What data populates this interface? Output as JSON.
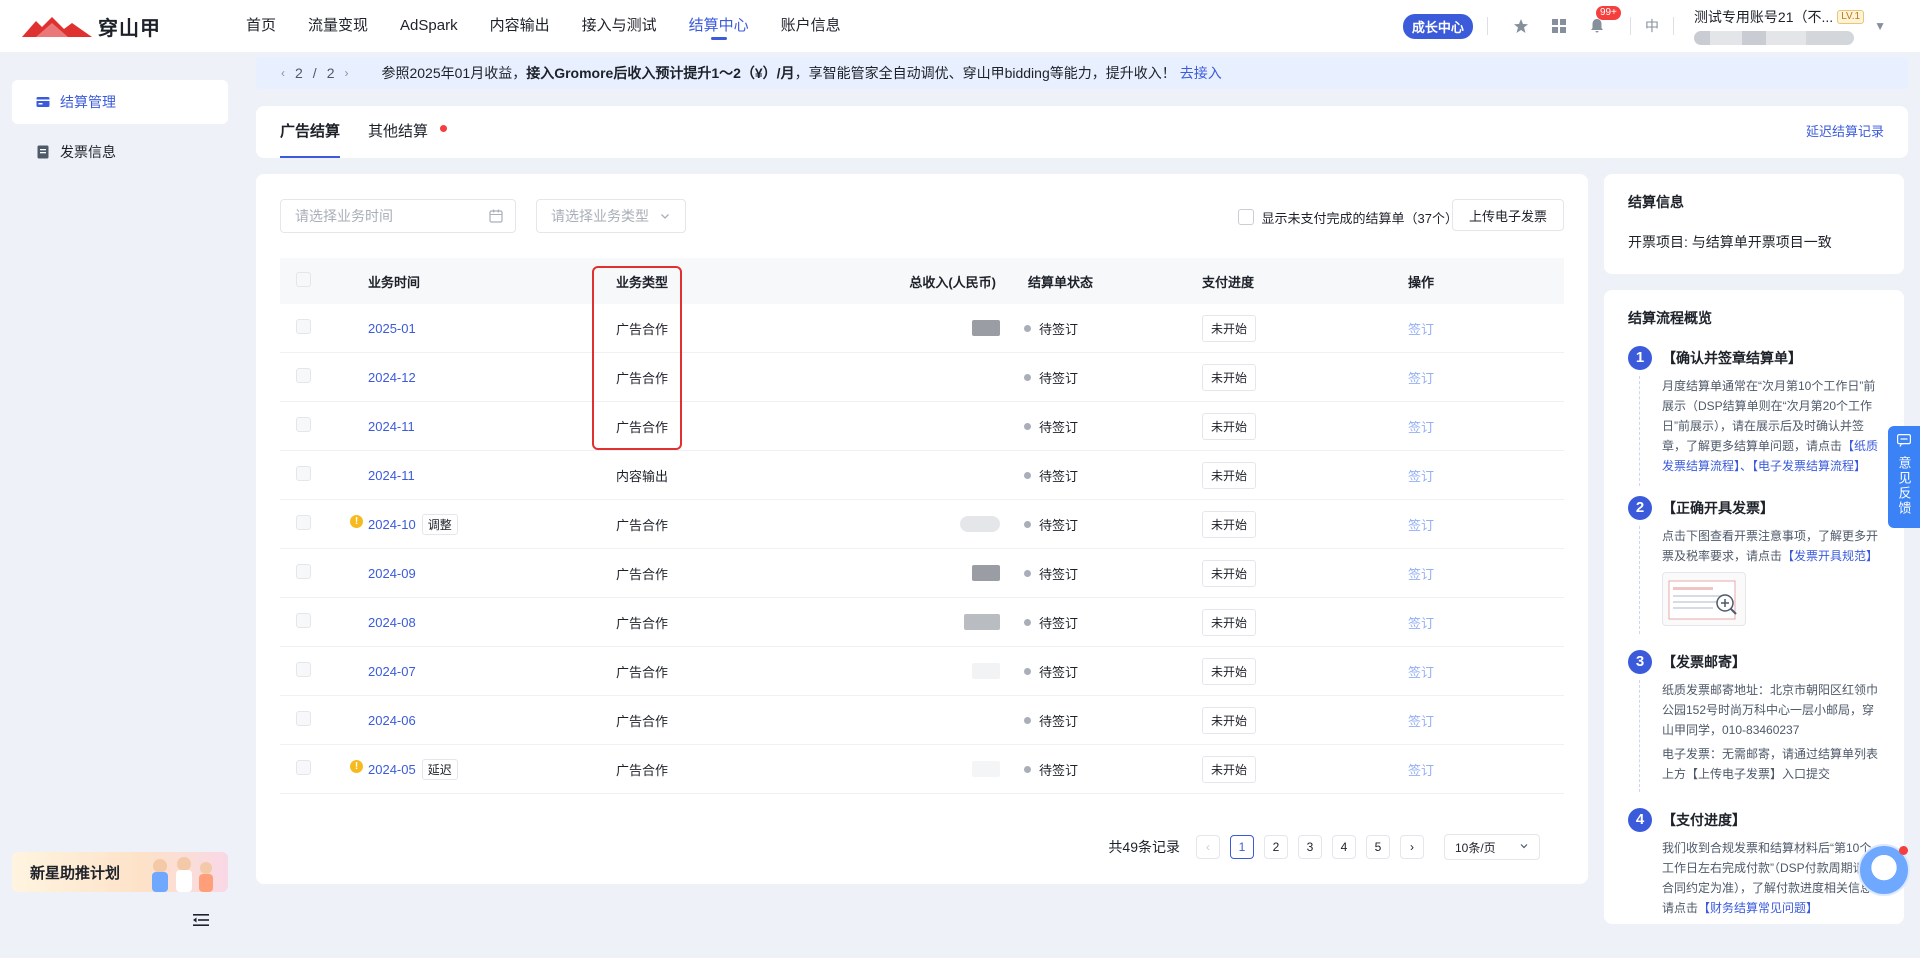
{
  "brand": {
    "name": "穿山甲"
  },
  "nav": {
    "items": [
      "首页",
      "流量变现",
      "AdSpark",
      "内容输出",
      "接入与测试",
      "结算中心",
      "账户信息"
    ],
    "active_index": 5
  },
  "header": {
    "grow_center": "成长中心",
    "notif_count": "99+",
    "lang": "中",
    "account_name": "测试专用账号21（不...",
    "level": "LV.1"
  },
  "sidebar": {
    "items": [
      {
        "label": "结算管理",
        "icon": "settlement-icon",
        "active": true
      },
      {
        "label": "发票信息",
        "icon": "invoice-icon",
        "active": false
      }
    ],
    "promo": "新星助推计划"
  },
  "notice": {
    "page_current": "2",
    "page_sep": "/",
    "page_total": "2",
    "text_before": "参照2025年01月收益，",
    "text_bold": "接入Gromore后收入预计提升1～2（¥）/月",
    "text_after": "，享智能管家全自动调优、穿山甲bidding等能力，提升收入！",
    "link": "去接入"
  },
  "tabs": {
    "items": [
      "广告结算",
      "其他结算"
    ],
    "delay_link": "延迟结算记录"
  },
  "filters": {
    "time_placeholder": "请选择业务时间",
    "type_placeholder": "请选择业务类型",
    "unpaid_label": "显示未支付完成的结算单（37个）",
    "upload_button": "上传电子发票"
  },
  "table": {
    "headers": [
      "业务时间",
      "业务类型",
      "总收入(人民币)",
      "结算单状态",
      "支付进度",
      "操作"
    ],
    "rows": [
      {
        "time": "2025-01",
        "tag": "",
        "warn": false,
        "type": "广告合作",
        "status": "待签订",
        "progress": "未开始",
        "op": "签订"
      },
      {
        "time": "2024-12",
        "tag": "",
        "warn": false,
        "type": "广告合作",
        "status": "待签订",
        "progress": "未开始",
        "op": "签订"
      },
      {
        "time": "2024-11",
        "tag": "",
        "warn": false,
        "type": "广告合作",
        "status": "待签订",
        "progress": "未开始",
        "op": "签订"
      },
      {
        "time": "2024-11",
        "tag": "",
        "warn": false,
        "type": "内容输出",
        "status": "待签订",
        "progress": "未开始",
        "op": "签订"
      },
      {
        "time": "2024-10",
        "tag": "调整",
        "warn": true,
        "type": "广告合作",
        "status": "待签订",
        "progress": "未开始",
        "op": "签订"
      },
      {
        "time": "2024-09",
        "tag": "",
        "warn": false,
        "type": "广告合作",
        "status": "待签订",
        "progress": "未开始",
        "op": "签订"
      },
      {
        "time": "2024-08",
        "tag": "",
        "warn": false,
        "type": "广告合作",
        "status": "待签订",
        "progress": "未开始",
        "op": "签订"
      },
      {
        "time": "2024-07",
        "tag": "",
        "warn": false,
        "type": "广告合作",
        "status": "待签订",
        "progress": "未开始",
        "op": "签订"
      },
      {
        "time": "2024-06",
        "tag": "",
        "warn": false,
        "type": "广告合作",
        "status": "待签订",
        "progress": "未开始",
        "op": "签订"
      },
      {
        "time": "2024-05",
        "tag": "延迟",
        "warn": true,
        "type": "广告合作",
        "status": "待签订",
        "progress": "未开始",
        "op": "签订"
      }
    ]
  },
  "pagination": {
    "total": "共49条记录",
    "pages": [
      "1",
      "2",
      "3",
      "4",
      "5"
    ],
    "current": "1",
    "page_size": "10条/页"
  },
  "settlement_info": {
    "title": "结算信息",
    "text": "开票项目: 与结算单开票项目一致"
  },
  "flow": {
    "title": "结算流程概览",
    "steps": [
      {
        "num": "1",
        "title": "【确认并签章结算单】",
        "desc": "月度结算单通常在“次月第10个工作日”前展示（DSP结算单则在“次月第20个工作日”前展示），请在展示后及时确认并签章，了解更多结算单问题，请点击",
        "link": "【纸质发票结算流程】、【电子发票结算流程】"
      },
      {
        "num": "2",
        "title": "【正确开具发票】",
        "desc": "点击下图查看开票注意事项，了解更多开票及税率要求，请点击",
        "link": "【发票开具规范】"
      },
      {
        "num": "3",
        "title": "【发票邮寄】",
        "desc": "纸质发票邮寄地址：北京市朝阳区红领巾公园152号时尚万科中心一层小邮局，穿山甲同学，010-83460237",
        "desc2": "电子发票：无需邮寄，请通过结算单列表上方【上传电子发票】入口提交"
      },
      {
        "num": "4",
        "title": "【支付进度】",
        "desc": "我们收到合规发票和结算材料后“第10个工作日左右完成付款”（DSP付款周期请以合同约定为准），了解付款进度相关信息,请点击",
        "link": "【财务结算常见问题】"
      }
    ]
  },
  "feedback": {
    "label": "意见反馈"
  }
}
